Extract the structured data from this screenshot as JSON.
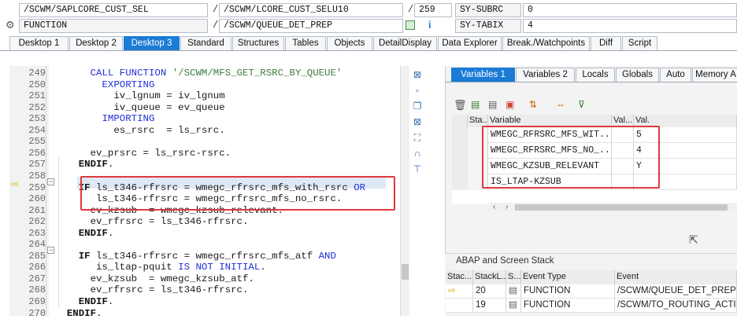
{
  "header": {
    "row1": {
      "program": "/SCWM/SAPLCORE_CUST_SEL",
      "include": "/SCWM/LCORE_CUST_SELU10",
      "line": "259",
      "sysvar": "SY-SUBRC",
      "sysval": "0"
    },
    "row2": {
      "type": "FUNCTION",
      "name": "/SCWM/QUEUE_DET_PREP",
      "sysvar": "SY-TABIX",
      "sysval": "4"
    },
    "slash": "/",
    "gear_icon": "gear-icon",
    "accent": "#1b7bd6"
  },
  "tabs": [
    "Desktop 1",
    "Desktop 2",
    "Desktop 3",
    "Standard",
    "Structures",
    "Tables",
    "Objects",
    "DetailDisplay",
    "Data Explorer",
    "Break./Watchpoints",
    "Diff",
    "Script"
  ],
  "code": {
    "lines": [
      {
        "no": "249",
        "text": "      CALL FUNCTION '/SCWM/MFS_GET_RSRC_BY_QUEUE'"
      },
      {
        "no": "250",
        "text": "        EXPORTING"
      },
      {
        "no": "251",
        "text": "          iv_lgnum = iv_lgnum"
      },
      {
        "no": "252",
        "text": "          iv_queue = ev_queue"
      },
      {
        "no": "253",
        "text": "        IMPORTING"
      },
      {
        "no": "254",
        "text": "          es_rsrc  = ls_rsrc."
      },
      {
        "no": "255",
        "text": ""
      },
      {
        "no": "256",
        "text": "      ev_prsrc = ls_rsrc-rsrc."
      },
      {
        "no": "257",
        "text": "    ENDIF."
      },
      {
        "no": "258",
        "text": ""
      },
      {
        "no": "259",
        "text": "    IF ls_t346-rfrsrc = wmegc_rfrsrc_mfs_with_rsrc OR"
      },
      {
        "no": "260",
        "text": "       ls_t346-rfrsrc = wmegc_rfrsrc_mfs_no_rsrc."
      },
      {
        "no": "261",
        "text": "      ev_kzsub  = wmegc_kzsub_relevant."
      },
      {
        "no": "262",
        "text": "      ev_rfrsrc = ls_t346-rfrsrc."
      },
      {
        "no": "263",
        "text": "    ENDIF."
      },
      {
        "no": "264",
        "text": ""
      },
      {
        "no": "265",
        "text": "    IF ls_t346-rfrsrc = wmegc_rfrsrc_mfs_atf AND"
      },
      {
        "no": "266",
        "text": "       is_ltap-pquit IS NOT INITIAL."
      },
      {
        "no": "267",
        "text": "      ev_kzsub  = wmegc_kzsub_atf."
      },
      {
        "no": "268",
        "text": "      ev_rfrsrc = ls_t346-rfrsrc."
      },
      {
        "no": "269",
        "text": "    ENDIF."
      },
      {
        "no": "270",
        "text": "  ENDIF."
      }
    ],
    "current_line": "259"
  },
  "vars": {
    "tabs": [
      "Variables 1",
      "Variables 2",
      "Locals",
      "Globals",
      "Auto",
      "Memory A"
    ],
    "columns": [
      "Sta...",
      "Variable",
      "Val...",
      "Val."
    ],
    "rows": [
      {
        "variable": "WMEGC_RFRSRC_MFS_WIT...",
        "value": "5"
      },
      {
        "variable": "WMEGC_RFRSRC_MFS_NO_...",
        "value": "4"
      },
      {
        "variable": "WMEGC_KZSUB_RELEVANT",
        "value": "Y"
      },
      {
        "variable": "IS_LTAP-KZSUB",
        "value": ""
      }
    ]
  },
  "stack": {
    "title": "ABAP and Screen Stack",
    "columns": [
      "Stac...",
      "StackL...",
      "S...",
      "Event Type",
      "Event"
    ],
    "rows": [
      {
        "level": "20",
        "type": "FUNCTION",
        "event": "/SCWM/QUEUE_DET_PREP"
      },
      {
        "level": "19",
        "type": "FUNCTION",
        "event": "/SCWM/TO_ROUTING_ACTIVAT..."
      }
    ]
  }
}
